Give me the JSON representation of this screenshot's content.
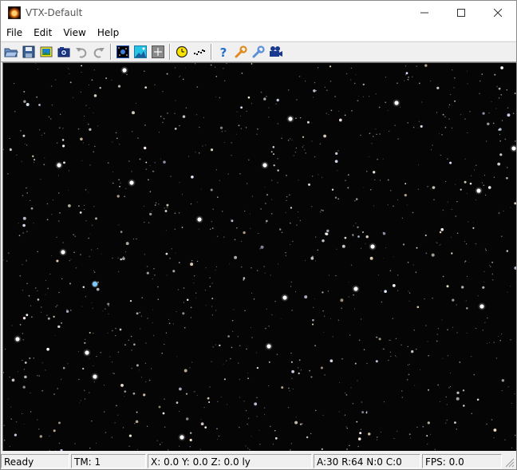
{
  "window": {
    "title": "VTX-Default"
  },
  "menu": {
    "items": [
      "File",
      "Edit",
      "View",
      "Help"
    ]
  },
  "toolbar": {
    "buttons": [
      {
        "icon": "open-folder-icon"
      },
      {
        "icon": "save-icon"
      },
      {
        "icon": "image-icon"
      },
      {
        "icon": "camera-icon"
      },
      {
        "icon": "undo-icon"
      },
      {
        "icon": "redo-icon"
      },
      {
        "icon": "starfield-icon"
      },
      {
        "icon": "landscape-icon"
      },
      {
        "icon": "grid-icon"
      },
      {
        "icon": "clock-icon"
      },
      {
        "icon": "scatter-icon"
      },
      {
        "icon": "help-icon"
      },
      {
        "icon": "wrench-icon"
      },
      {
        "icon": "tools-icon"
      },
      {
        "icon": "video-camera-icon"
      }
    ]
  },
  "status": {
    "ready": "Ready",
    "tm": "TM: 1",
    "position": "X: 0.0 Y: 0.0 Z: 0.0 ly",
    "params": "A:30  R:64  N:0  C:0",
    "fps": "FPS: 0.0"
  },
  "colors": {
    "viewport_bg": "#050505",
    "chrome": "#f0f0f0",
    "titlebar": "#ffffff"
  }
}
